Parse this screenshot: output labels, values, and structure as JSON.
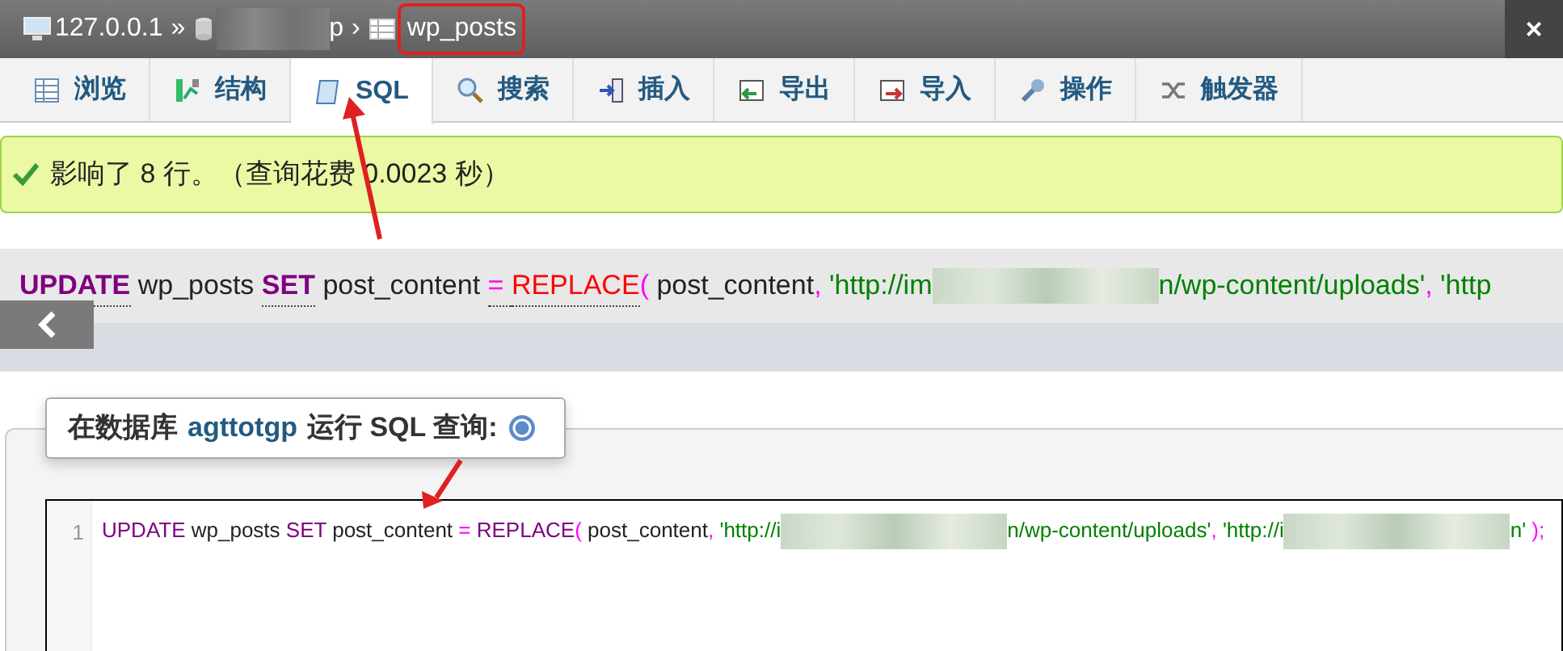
{
  "breadcrumb": [
    {
      "kind": "server",
      "text": "127.0.0.1"
    },
    {
      "kind": "separator",
      "text": "»"
    },
    {
      "kind": "database",
      "text": "p",
      "redacted": true
    },
    {
      "kind": "separator",
      "text": "›"
    },
    {
      "kind": "table",
      "text": "wp_posts",
      "highlighted": true
    }
  ],
  "close": "×",
  "tabs": [
    {
      "label": "浏览",
      "kind": "browse",
      "selected": false
    },
    {
      "label": "结构",
      "kind": "structure",
      "selected": false
    },
    {
      "label": "SQL",
      "kind": "sql",
      "selected": true
    },
    {
      "label": "搜索",
      "kind": "search",
      "selected": false
    },
    {
      "label": "插入",
      "kind": "insert",
      "selected": false
    },
    {
      "label": "导出",
      "kind": "export",
      "selected": false
    },
    {
      "label": "导入",
      "kind": "import",
      "selected": false
    },
    {
      "label": "操作",
      "kind": "operations",
      "selected": false
    },
    {
      "label": "触发器",
      "kind": "triggers",
      "selected": false
    }
  ],
  "message": {
    "kind": "success",
    "text": "影响了 8 行。（查询花费 0.0023 秒）"
  },
  "sql_preview": [
    {
      "kind": "keyword",
      "text": "UPDATE"
    },
    {
      "kind": "plain",
      "text": " wp_posts "
    },
    {
      "kind": "keyword",
      "text": "SET"
    },
    {
      "kind": "plain",
      "text": " post_content "
    },
    {
      "kind": "operator",
      "text": "= "
    },
    {
      "kind": "function",
      "text": "REPLACE"
    },
    {
      "kind": "punct",
      "text": "("
    },
    {
      "kind": "plain",
      "text": " post_content"
    },
    {
      "kind": "punct",
      "text": ","
    },
    {
      "kind": "string",
      "text": " 'http://im"
    },
    {
      "kind": "redacted"
    },
    {
      "kind": "string",
      "text": "n/wp-content/uploads'"
    },
    {
      "kind": "punct",
      "text": ","
    },
    {
      "kind": "string",
      "text": " 'http"
    }
  ],
  "query_box": {
    "prefix": "在数据库",
    "database": "agttotgp",
    "suffix": "运行 SQL 查询:"
  },
  "editor": {
    "line_number": "1",
    "tokens": [
      {
        "kind": "keyword",
        "text": "UPDATE"
      },
      {
        "kind": "plain",
        "text": " wp_posts "
      },
      {
        "kind": "keyword",
        "text": "SET"
      },
      {
        "kind": "plain",
        "text": " post_content "
      },
      {
        "kind": "operator",
        "text": "= "
      },
      {
        "kind": "keyword",
        "text": "REPLACE"
      },
      {
        "kind": "punct",
        "text": "("
      },
      {
        "kind": "plain",
        "text": " post_content"
      },
      {
        "kind": "punct",
        "text": ","
      },
      {
        "kind": "string",
        "text": " 'http://i"
      },
      {
        "kind": "redacted"
      },
      {
        "kind": "string",
        "text": "n/wp-content/uploads'"
      },
      {
        "kind": "punct",
        "text": ","
      },
      {
        "kind": "string",
        "text": " 'http://i"
      },
      {
        "kind": "redacted"
      },
      {
        "kind": "string",
        "text": "n'"
      },
      {
        "kind": "punct",
        "text": " );"
      }
    ]
  }
}
